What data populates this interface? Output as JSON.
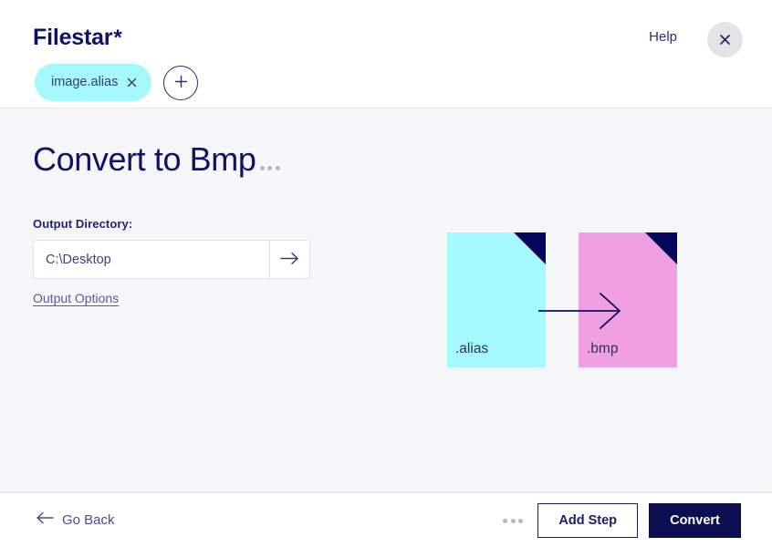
{
  "header": {
    "brand_name": "Filestar",
    "brand_mark": "*",
    "help_label": "Help",
    "close_icon": "close-icon",
    "files": [
      {
        "name": "image.alias",
        "remove_icon": "close-icon"
      }
    ],
    "add_file_icon": "plus-icon"
  },
  "main": {
    "title": "Convert to Bmp",
    "title_menu_icon": "ellipsis-icon",
    "output_directory_label": "Output Directory:",
    "output_directory_value": "C:\\Desktop",
    "output_directory_placeholder": "C:\\Desktop",
    "go_icon": "arrow-right-icon",
    "output_options_label": "Output Options",
    "conversion": {
      "source_extension": ".alias",
      "target_extension": ".bmp",
      "arrow_icon": "arrow-right-icon",
      "source_color": "#a5f9fc",
      "target_color": "#f0a0e2",
      "corner_color": "#06055c"
    }
  },
  "footer": {
    "go_back_label": "Go Back",
    "go_back_icon": "arrow-left-icon",
    "more_icon": "ellipsis-icon",
    "add_step_label": "Add Step",
    "convert_label": "Convert"
  },
  "theme": {
    "navy": "#0d0d52",
    "accent_cyan": "#a5f9fc",
    "accent_pink": "#f0a0e2",
    "page_bg": "#f5f6f8"
  }
}
